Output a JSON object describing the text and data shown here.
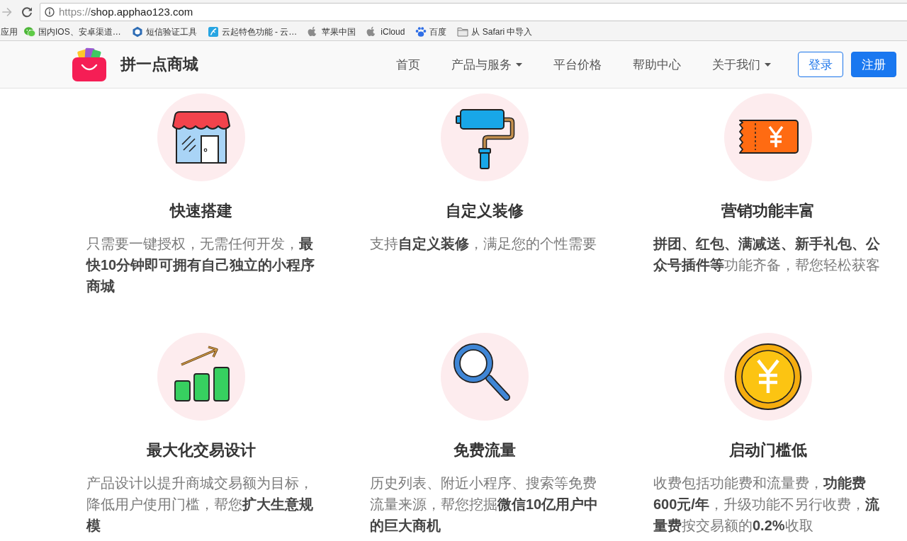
{
  "browser": {
    "url_scheme": "https://",
    "url_host": "shop.apphao123.com",
    "bookmarks": [
      {
        "kind": "text",
        "label": "应用"
      },
      {
        "kind": "chat",
        "label": "国内IOS、安卓渠道…"
      },
      {
        "kind": "hexagon",
        "label": "短信验证工具"
      },
      {
        "kind": "app",
        "label": "云起特色功能 - 云…"
      },
      {
        "kind": "apple",
        "label": "苹果中国"
      },
      {
        "kind": "apple",
        "label": "iCloud"
      },
      {
        "kind": "paw",
        "label": "百度"
      },
      {
        "kind": "folder",
        "label": "从 Safari 中导入"
      }
    ]
  },
  "header": {
    "site_name": "拼一点商城",
    "links": [
      {
        "label": "首页",
        "dropdown": false
      },
      {
        "label": "产品与服务",
        "dropdown": true
      },
      {
        "label": "平台价格",
        "dropdown": false
      },
      {
        "label": "帮助中心",
        "dropdown": false
      },
      {
        "label": "关于我们",
        "dropdown": true
      }
    ],
    "buttons": [
      {
        "label": "登录",
        "kind": "outline"
      },
      {
        "label": "注册",
        "kind": "filled"
      }
    ]
  },
  "features": [
    {
      "kind": "store",
      "title": "快速搭建",
      "text": "只需要一键授权，无需任何开发，**最快10分钟即可拥有自己独立的小程序商城**"
    },
    {
      "kind": "roller",
      "title": "自定义装修",
      "text": "支持**自定义装修**，满足您的个性需要"
    },
    {
      "kind": "ticket",
      "title": "营销功能丰富",
      "text": "**拼团、红包、满减送、新手礼包、公众号插件等**功能齐备，帮您轻松获客"
    },
    {
      "kind": "chart",
      "title": "最大化交易设计",
      "text": "产品设计以提升商城交易额为目标，降低用户使用门槛，帮您**扩大生意规模**"
    },
    {
      "kind": "magnifier",
      "title": "免费流量",
      "text": "历史列表、附近小程序、搜索等免费流量来源，帮您挖掘**微信10亿用户中的巨大商机**"
    },
    {
      "kind": "coin",
      "title": "启动门槛低",
      "text": "收费包括功能费和流量费，**功能费600元/年**，升级功能不另行收费，**流量费**按交易额的**0.2%**收取"
    }
  ]
}
